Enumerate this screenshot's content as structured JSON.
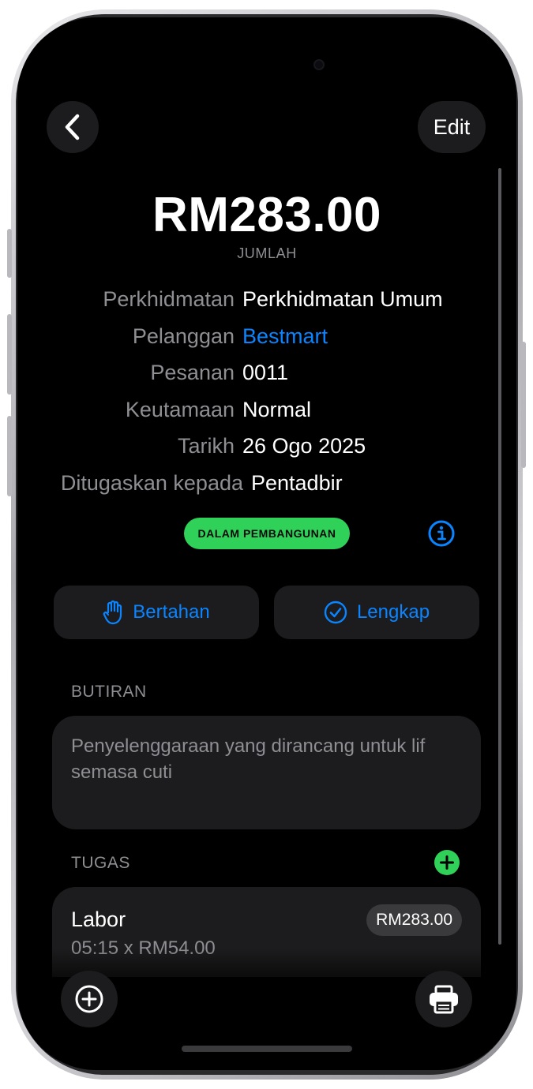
{
  "nav": {
    "back_icon": "chevron-left-icon",
    "edit_label": "Edit"
  },
  "summary": {
    "amount": "RM283.00",
    "amount_label": "JUMLAH"
  },
  "details": [
    {
      "key": "Perkhidmatan",
      "value": "Perkhidmatan Umum"
    },
    {
      "key": "Pelanggan",
      "value": "Bestmart"
    },
    {
      "key": "Pesanan",
      "value": "0011"
    },
    {
      "key": "Keutamaan",
      "value": "Normal"
    },
    {
      "key": "Tarikh",
      "value": "26 Ogo 2025"
    },
    {
      "key": "Ditugaskan kepada",
      "value": "Pentadbir"
    }
  ],
  "status": {
    "badge": "DALAM PEMBANGUNAN",
    "badge_color": "#30d158",
    "info_icon": "info-circle-icon"
  },
  "actions": {
    "hold_label": "Bertahan",
    "hold_icon": "hand-raised-icon",
    "complete_label": "Lengkap",
    "complete_icon": "checkmark-circle-icon"
  },
  "description": {
    "label": "BUTIRAN",
    "text": "Penyelenggaraan yang dirancang untuk lif semasa cuti"
  },
  "tasks": {
    "label": "TUGAS",
    "add_icon": "plus-circle-icon",
    "items": [
      {
        "title": "Labor",
        "detail": "05:15 x RM54.00",
        "price": "RM283.00"
      }
    ]
  },
  "toolbar": {
    "add_icon": "plus-circle-icon",
    "print_icon": "printer-icon"
  },
  "colors": {
    "accent": "#0a84ff",
    "background": "#000000",
    "card": "#1c1c1e",
    "secondary_text": "#8e8e93"
  }
}
